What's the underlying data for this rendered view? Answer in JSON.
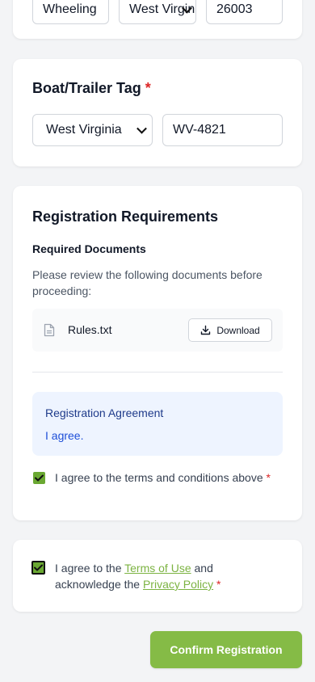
{
  "address_row": {
    "city_value": "Wheeling",
    "state_value": "West Virginia",
    "zip_value": "26003"
  },
  "boat_tag": {
    "title": "Boat/Trailer Tag",
    "required_mark": "*",
    "state_value": "West Virginia",
    "tag_value": "WV-4821"
  },
  "requirements": {
    "title": "Registration Requirements",
    "documents_heading": "Required Documents",
    "documents_note": "Please review the following documents before proceeding:",
    "file_name": "Rules.txt",
    "download_label": "Download",
    "agreement_title": "Registration Agreement",
    "agreement_text": "I agree.",
    "terms_checkbox_label": "I agree to the terms and conditions above",
    "required_mark": "*"
  },
  "consent": {
    "prefix": "I agree to the ",
    "terms_link": "Terms of Use",
    "middle": " and acknowledge the ",
    "privacy_link": "Privacy Policy",
    "required_mark": "*"
  },
  "actions": {
    "confirm_label": "Confirm Registration"
  },
  "colors": {
    "accent": "#85bb46",
    "required": "#dc2626",
    "agreement_bg": "#eef4ff"
  }
}
